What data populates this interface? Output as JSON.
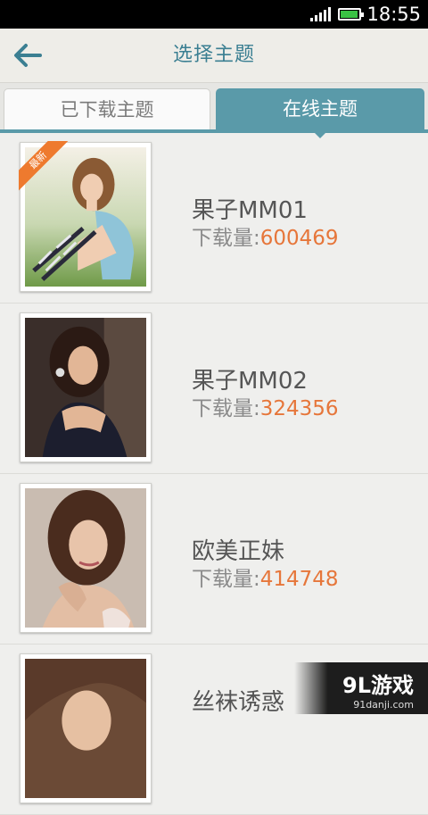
{
  "status_bar": {
    "time": "18:55",
    "battery_level": 0.95,
    "battery_color": "#3ac244"
  },
  "header": {
    "back_icon": "arrow-left-icon",
    "title": "选择主题",
    "title_color": "#3b7f92"
  },
  "tabs": [
    {
      "label": "已下载主题",
      "active": false
    },
    {
      "label": "在线主题",
      "active": true
    }
  ],
  "accent_color": "#5a9aa9",
  "download_label": "下载量:",
  "items": [
    {
      "name": "果子MM01",
      "downloads": "600469",
      "badge": "最新"
    },
    {
      "name": "果子MM02",
      "downloads": "324356"
    },
    {
      "name": "欧美正妹",
      "downloads": "414748"
    },
    {
      "name": "丝袜诱惑"
    }
  ],
  "watermark": {
    "logo": "9L游戏",
    "url": "91danji.com"
  }
}
